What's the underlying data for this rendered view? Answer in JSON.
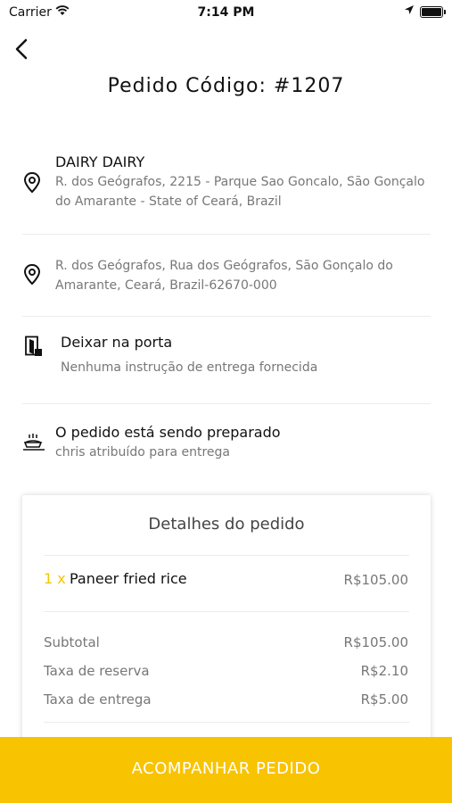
{
  "status_bar": {
    "carrier": "Carrier",
    "time": "7:14 PM"
  },
  "header": {
    "title": "Pedido Código: #1207"
  },
  "restaurant": {
    "name": "DAIRY DAIRY",
    "address": "R. dos Geógrafos, 2215 - Parque Sao Goncalo, São Gonçalo do Amarante - State of Ceará, Brazil"
  },
  "delivery": {
    "address": "R. dos Geógrafos, Rua dos Geógrafos, São Gonçalo do Amarante, Ceará, Brazil-62670-000"
  },
  "instructions": {
    "title": "Deixar na porta",
    "subtitle": "Nenhuma instrução de entrega fornecida"
  },
  "order_status": {
    "title": "O pedido está sendo preparado",
    "subtitle": "chris atribuído para entrega"
  },
  "details": {
    "title": "Detalhes do pedido",
    "items": [
      {
        "qty": "1 x",
        "name": "Paneer fried rice",
        "price": "R$105.00"
      }
    ],
    "summary": [
      {
        "label": "Subtotal",
        "value": "R$105.00"
      },
      {
        "label": "Taxa de reserva",
        "value": "R$2.10"
      },
      {
        "label": "Taxa de entrega",
        "value": "R$5.00"
      }
    ]
  },
  "track_button": {
    "label": "ACOMPANHAR PEDIDO"
  },
  "colors": {
    "accent": "#f8c300",
    "text_muted": "#777777"
  }
}
